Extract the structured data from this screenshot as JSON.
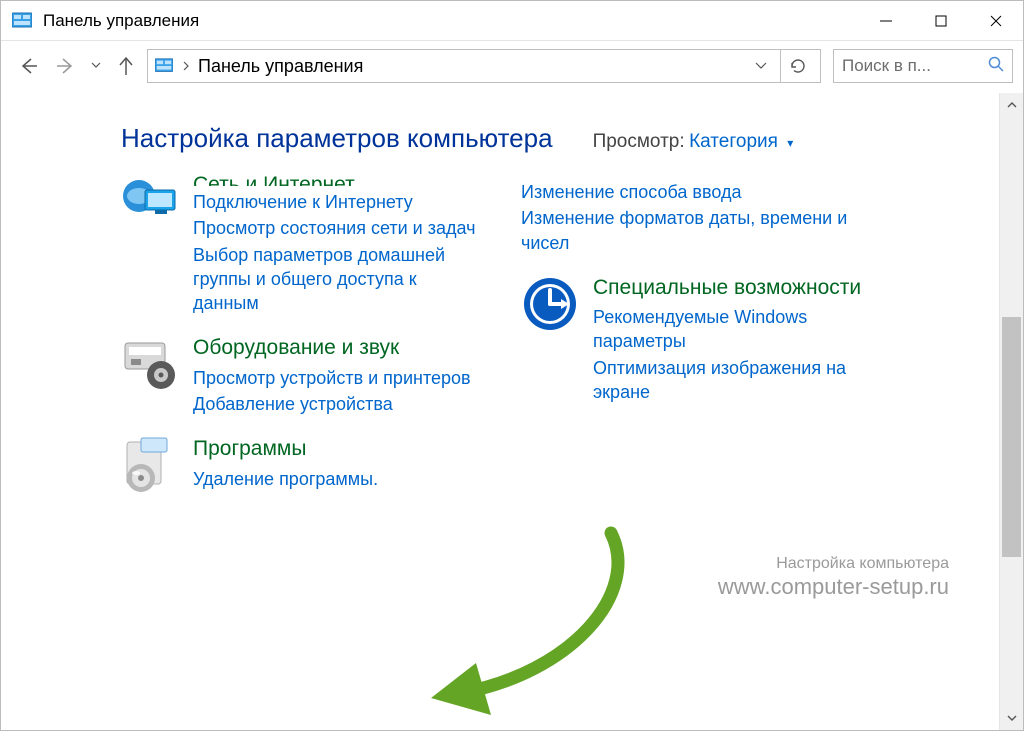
{
  "window": {
    "title": "Панель управления"
  },
  "address": {
    "crumb": "Панель управления"
  },
  "search": {
    "placeholder": "Поиск в п..."
  },
  "header": {
    "heading": "Настройка параметров компьютера",
    "view_label": "Просмотр:",
    "view_value": "Категория"
  },
  "left": {
    "network": {
      "title_partial": "Сеть и Интернет",
      "links": [
        "Подключение к Интернету",
        "Просмотр состояния сети и задач",
        "Выбор параметров домашней группы и общего доступа к данным"
      ]
    },
    "hardware": {
      "title": "Оборудование и звук",
      "links": [
        "Просмотр устройств и принтеров",
        "Добавление устройства"
      ]
    },
    "programs": {
      "title": "Программы",
      "links": [
        "Удаление программы."
      ]
    }
  },
  "right": {
    "region": {
      "links": [
        "Изменение способа ввода",
        "Изменение форматов даты, времени и чисел"
      ]
    },
    "ease": {
      "title": "Специальные возможности",
      "links": [
        "Рекомендуемые Windows параметры",
        "Оптимизация изображения на экране"
      ]
    }
  },
  "watermark": {
    "small": "Настройка компьютера",
    "big": "www.computer-setup.ru"
  }
}
